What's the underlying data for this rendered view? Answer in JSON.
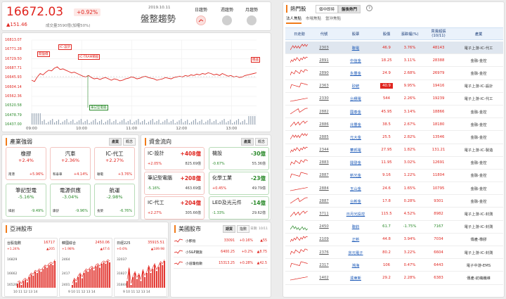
{
  "header": {
    "price": "16672.03",
    "pct": "+0.92%",
    "change": "▲151.46",
    "volume": "成交量3590億(加權50%)",
    "date": "2019.10.11",
    "trend": "盤整趨勢",
    "trend_tabs": [
      {
        "label": "日趨勢",
        "active": true
      },
      {
        "label": "週趨勢",
        "active": false
      },
      {
        "label": "月趨勢",
        "active": false
      }
    ]
  },
  "intraday": {
    "y_labels": [
      "16813.07",
      "16771.28",
      "16729.50",
      "16687.71",
      "16645.93",
      "16604.14",
      "16562.36",
      "16520.58",
      "16478.79",
      "16437.00"
    ],
    "x_labels": [
      "09:00",
      "10:00",
      "11:00",
      "12:00",
      "13:00"
    ],
    "annotations": {
      "low_start": "開盤價",
      "electronic": "IC-設計",
      "tram": "IC-TRAM類股",
      "pc": "筆記型電腦",
      "tip": "機器"
    }
  },
  "industry": {
    "title": "產業強弱",
    "tabs": [
      "產業",
      "概念"
    ],
    "cards": [
      {
        "name": "橡膠",
        "pct": "+2.4%",
        "lead": "南港",
        "lpct": "+5.96%",
        "up": true
      },
      {
        "name": "汽車",
        "pct": "+2.36%",
        "lead": "和泰車",
        "lpct": "+4.14%",
        "up": true
      },
      {
        "name": "IC-代工",
        "pct": "+2.27%",
        "lead": "聯電",
        "lpct": "+3.76%",
        "up": true
      },
      {
        "name": "筆記型電",
        "pct": "-5.16%",
        "lead": "緯創",
        "lpct": "-9.49%",
        "up": false
      },
      {
        "name": "電源供應",
        "pct": "-3.04%",
        "lead": "康舒",
        "lpct": "-9.96%",
        "up": false
      },
      {
        "name": "航運",
        "pct": "-2.98%",
        "lead": "長榮",
        "lpct": "-6.76%",
        "up": false
      }
    ]
  },
  "flow": {
    "title": "資金流向",
    "tabs": [
      "產業",
      "概念"
    ],
    "cards": [
      {
        "name": "IC-設計",
        "val": "+408億",
        "pct": "+2.05%",
        "sum": "825.69億",
        "up": true
      },
      {
        "name": "機設",
        "val": "-30億",
        "pct": "-0.67%",
        "sum": "55.36億",
        "up": false
      },
      {
        "name": "筆記型電腦",
        "val": "+208億",
        "pct": "-5.16%",
        "sum": "463.69億",
        "up": true
      },
      {
        "name": "化學工業",
        "val": "-23億",
        "pct": "+0.45%",
        "sum": "49.79億",
        "up": false
      },
      {
        "name": "IC-代工",
        "val": "+204億",
        "pct": "+2.27%",
        "sum": "305.66億",
        "up": true
      },
      {
        "name": "LED及光元件",
        "val": "-14億",
        "pct": "-1.33%",
        "sum": "29.62億",
        "up": false
      }
    ]
  },
  "asia": {
    "title": "亞洲股市",
    "markets": [
      {
        "name": "台股指數",
        "value": "16717",
        "pct": "+1.24%",
        "chg": "▲205",
        "yhigh": "16829",
        "ymid": "16662",
        "ylow": "16526",
        "x": "10 11 12 13 14",
        "series": [
          5,
          6,
          4,
          7,
          8,
          6,
          10,
          12,
          11,
          14,
          13,
          15,
          14,
          16,
          18,
          17,
          19,
          20,
          19,
          22
        ]
      },
      {
        "name": "韓國綜合",
        "value": "2450.06",
        "pct": "+1.98%",
        "chg": "▲47.6",
        "yhigh": "2464",
        "ymid": "2417",
        "ylow": "2401",
        "x": "9 10 11 12 13 14",
        "series": [
          4,
          8,
          6,
          10,
          12,
          9,
          13,
          15,
          14,
          16,
          17,
          15,
          18,
          19,
          17,
          20,
          21,
          20,
          22,
          21
        ]
      },
      {
        "name": "日經225",
        "value": "35915.51",
        "pct": "+0.6%",
        "chg": "▲189.98",
        "yhigh": "32037",
        "ymid": "31827",
        "ylow": "31844",
        "x": "9 10 11 12 13 14",
        "series": [
          8,
          14,
          6,
          10,
          12,
          9,
          11,
          8,
          13,
          10,
          12,
          15,
          12,
          14,
          16,
          13,
          15,
          17,
          16,
          18
        ]
      }
    ]
  },
  "us": {
    "title": "美國股市",
    "tabs": [
      "期貨",
      "指數"
    ],
    "time": "日期: 10/11",
    "rows": [
      {
        "name": "小那指",
        "value": "33091",
        "pct": "+0.16%",
        "chg": "▲55"
      },
      {
        "name": "小S&P期貨",
        "value": "6400.25",
        "pct": "+0.2%",
        "chg": "▲8.75"
      },
      {
        "name": "小道瓊指數",
        "value": "15313.25",
        "pct": "+0.28%",
        "chg": "▲42.5"
      }
    ]
  },
  "hot": {
    "title": "熱門股",
    "market_tabs": [
      {
        "label": "個中即時",
        "active": false
      },
      {
        "label": "盤後熱門",
        "active": true
      }
    ],
    "sub_tabs": [
      {
        "label": "法人焦點",
        "active": true
      },
      {
        "label": "市場焦點",
        "active": false
      },
      {
        "label": "當沖焦點",
        "active": false
      }
    ],
    "headers": [
      "日走勢",
      "代號",
      "股票",
      "股價",
      "漲跌幅(%)",
      "買賣超張\n(10/11)",
      "產業"
    ],
    "rows": [
      {
        "code": "2303",
        "name": "聯電",
        "price": "46.9",
        "pct": "3.76%",
        "vol": "48143",
        "ind": "電子上游-IC-代工",
        "up": true,
        "lim": false
      },
      {
        "code": "2891",
        "name": "中信金",
        "price": "18.25",
        "pct": "3.11%",
        "vol": "28388",
        "ind": "金融-金控",
        "up": true,
        "lim": false
      },
      {
        "code": "2890",
        "name": "永豐金",
        "price": "24.9",
        "pct": "2.68%",
        "vol": "26979",
        "ind": "金融-金控",
        "up": true,
        "lim": false
      },
      {
        "code": "2363",
        "name": "矽統",
        "price": "40.9",
        "pct": "9.95%",
        "vol": "19416",
        "ind": "電子上游-IC-設計",
        "up": true,
        "lim": true
      },
      {
        "code": "2330",
        "name": "台積電",
        "price": "544",
        "pct": "2.26%",
        "vol": "19239",
        "ind": "電子上游-IC-代工",
        "up": true,
        "lim": false
      },
      {
        "code": "2882",
        "name": "國泰金",
        "price": "45.95",
        "pct": "3.14%",
        "vol": "18866",
        "ind": "金融-金控",
        "up": true,
        "lim": false
      },
      {
        "code": "2886",
        "name": "兆豐金",
        "price": "38.5",
        "pct": "2.67%",
        "vol": "18180",
        "ind": "金融-金控",
        "up": true,
        "lim": false
      },
      {
        "code": "2885",
        "name": "元大金",
        "price": "25.5",
        "pct": "2.82%",
        "vol": "13546",
        "ind": "金融-金控",
        "up": true,
        "lim": false
      },
      {
        "code": "2344",
        "name": "華邦電",
        "price": "27.95",
        "pct": "1.82%",
        "vol": "131.21",
        "ind": "電子上游-IC-製造",
        "up": true,
        "lim": false
      },
      {
        "code": "2883",
        "name": "開發金",
        "price": "11.95",
        "pct": "3.02%",
        "vol": "12691",
        "ind": "金融-金控",
        "up": true,
        "lim": false
      },
      {
        "code": "2887",
        "name": "新光金",
        "price": "9.16",
        "pct": "1.22%",
        "vol": "11804",
        "ind": "金融-金控",
        "up": true,
        "lim": false
      },
      {
        "code": "2884",
        "name": "玉山金",
        "price": "24.6",
        "pct": "1.65%",
        "vol": "10795",
        "ind": "金融-金控",
        "up": true,
        "lim": false
      },
      {
        "code": "2887",
        "name": "台新金",
        "price": "17.8",
        "pct": "0.28%",
        "vol": "9301",
        "ind": "金融-金控",
        "up": true,
        "lim": false
      },
      {
        "code": "3711",
        "name": "日月光投控",
        "price": "115.5",
        "pct": "4.52%",
        "vol": "8982",
        "ind": "電子上游-IC-封測",
        "up": true,
        "lim": false
      },
      {
        "code": "2450",
        "name": "聯鈞",
        "price": "61.7",
        "pct": "-1.75%",
        "vol": "7167",
        "ind": "電子上游-IC-封測",
        "up": false,
        "lim": false
      },
      {
        "code": "2109",
        "name": "正新",
        "price": "44.8",
        "pct": "3.94%",
        "vol": "7034",
        "ind": "傳產-橡膠",
        "up": true,
        "lim": false
      },
      {
        "code": "2376",
        "name": "京元電子",
        "price": "80.2",
        "pct": "3.22%",
        "vol": "6604",
        "ind": "電子上游-IC-封測",
        "up": true,
        "lim": false
      },
      {
        "code": "2317",
        "name": "鴻海",
        "price": "106",
        "pct": "0.47%",
        "vol": "6443",
        "ind": "電子中游-EMS",
        "up": true,
        "lim": false
      },
      {
        "code": "1402",
        "name": "遠東新",
        "price": "29.2",
        "pct": "2.28%",
        "vol": "6383",
        "ind": "傳產-紡織纖維",
        "up": true,
        "lim": false
      }
    ]
  }
}
